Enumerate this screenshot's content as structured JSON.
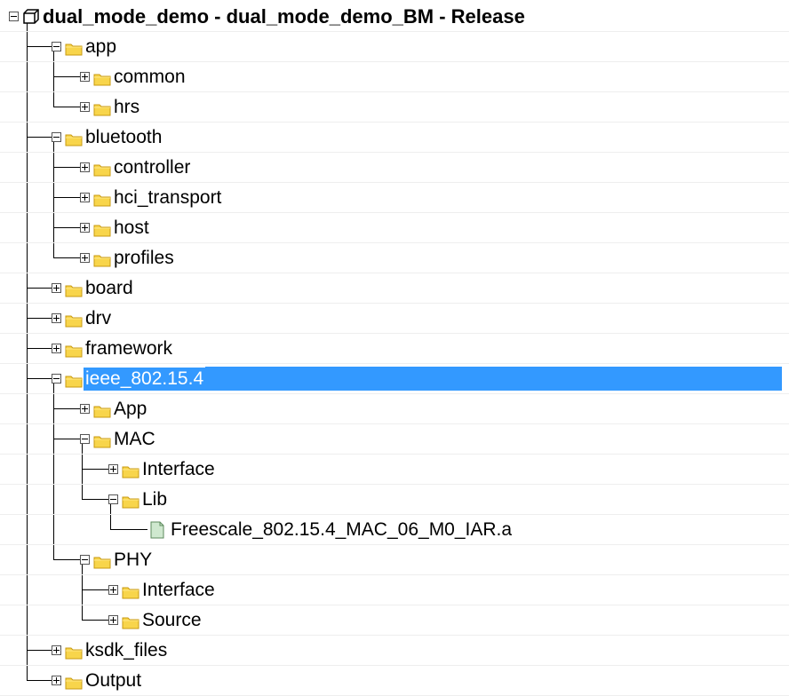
{
  "title": "dual_mode_demo - dual_mode_demo_BM - Release",
  "colors": {
    "folder_fill": "#f8d54b",
    "folder_stroke": "#c89a12",
    "selection": "#3399ff",
    "file_fill": "#cfe8cf"
  },
  "nodes": [
    {
      "label": "dual_mode_demo - dual_mode_demo_BM - Release",
      "depth": 0,
      "state": "expanded",
      "icon": "project-icon",
      "bold": true,
      "last": true
    },
    {
      "label": "app",
      "depth": 1,
      "state": "expanded",
      "icon": "folder-icon",
      "last": false
    },
    {
      "label": "common",
      "depth": 2,
      "state": "collapsed",
      "icon": "folder-icon",
      "last": false
    },
    {
      "label": "hrs",
      "depth": 2,
      "state": "collapsed",
      "icon": "folder-icon",
      "last": true
    },
    {
      "label": "bluetooth",
      "depth": 1,
      "state": "expanded",
      "icon": "folder-icon",
      "last": false
    },
    {
      "label": "controller",
      "depth": 2,
      "state": "collapsed",
      "icon": "folder-icon",
      "last": false
    },
    {
      "label": "hci_transport",
      "depth": 2,
      "state": "collapsed",
      "icon": "folder-icon",
      "last": false
    },
    {
      "label": "host",
      "depth": 2,
      "state": "collapsed",
      "icon": "folder-icon",
      "last": false
    },
    {
      "label": "profiles",
      "depth": 2,
      "state": "collapsed",
      "icon": "folder-icon",
      "last": true
    },
    {
      "label": "board",
      "depth": 1,
      "state": "collapsed",
      "icon": "folder-icon",
      "last": false
    },
    {
      "label": "drv",
      "depth": 1,
      "state": "collapsed",
      "icon": "folder-icon",
      "last": false
    },
    {
      "label": "framework",
      "depth": 1,
      "state": "collapsed",
      "icon": "folder-icon",
      "last": false
    },
    {
      "label": "ieee_802.15.4",
      "depth": 1,
      "state": "expanded",
      "icon": "folder-icon",
      "selected": true,
      "last": false
    },
    {
      "label": "App",
      "depth": 2,
      "state": "collapsed",
      "icon": "folder-icon",
      "last": false
    },
    {
      "label": "MAC",
      "depth": 2,
      "state": "expanded",
      "icon": "folder-icon",
      "last": false
    },
    {
      "label": "Interface",
      "depth": 3,
      "state": "collapsed",
      "icon": "folder-icon",
      "last": false
    },
    {
      "label": "Lib",
      "depth": 3,
      "state": "expanded",
      "icon": "folder-icon",
      "last": true
    },
    {
      "label": "Freescale_802.15.4_MAC_06_M0_IAR.a",
      "depth": 4,
      "state": "leaf",
      "icon": "file-icon",
      "last": true
    },
    {
      "label": "PHY",
      "depth": 2,
      "state": "expanded",
      "icon": "folder-icon",
      "last": true
    },
    {
      "label": "Interface",
      "depth": 3,
      "state": "collapsed",
      "icon": "folder-icon",
      "last": false
    },
    {
      "label": "Source",
      "depth": 3,
      "state": "collapsed",
      "icon": "folder-icon",
      "last": true
    },
    {
      "label": "ksdk_files",
      "depth": 1,
      "state": "collapsed",
      "icon": "folder-icon",
      "last": false
    },
    {
      "label": "Output",
      "depth": 1,
      "state": "collapsed",
      "icon": "folder-icon",
      "last": true
    }
  ]
}
